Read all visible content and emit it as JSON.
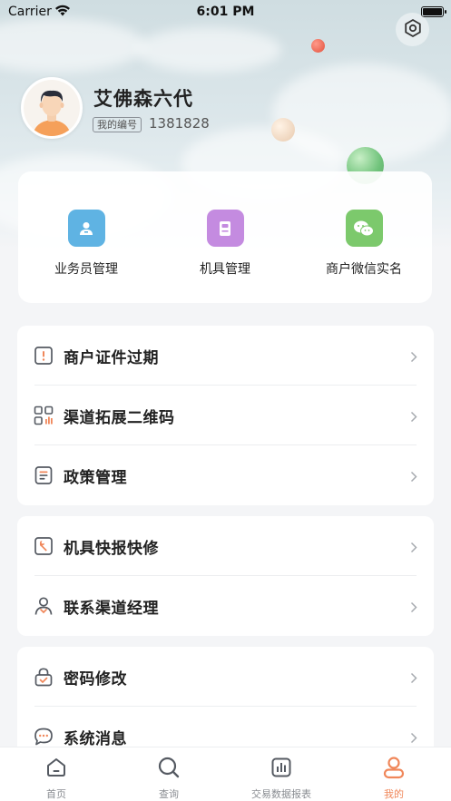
{
  "status_bar": {
    "carrier": "Carrier",
    "time": "6:01 PM"
  },
  "profile": {
    "name": "艾佛森六代",
    "id_label": "我的编号",
    "id_value": "1381828"
  },
  "quick_actions": [
    {
      "label": "业务员管理",
      "icon": "salesman-icon",
      "color": "#5fb3e3"
    },
    {
      "label": "机具管理",
      "icon": "device-icon",
      "color": "#c48be0"
    },
    {
      "label": "商户微信实名",
      "icon": "wechat-icon",
      "color": "#7cc96c"
    }
  ],
  "groups": [
    [
      {
        "label": "商户证件过期",
        "icon": "alert-icon"
      },
      {
        "label": "渠道拓展二维码",
        "icon": "qrcode-icon"
      },
      {
        "label": "政策管理",
        "icon": "document-icon"
      }
    ],
    [
      {
        "label": "机具快报快修",
        "icon": "wrench-icon"
      },
      {
        "label": "联系渠道经理",
        "icon": "contact-icon"
      }
    ],
    [
      {
        "label": "密码修改",
        "icon": "lock-icon"
      },
      {
        "label": "系统消息",
        "icon": "message-icon"
      }
    ]
  ],
  "tabs": [
    {
      "label": "首页",
      "icon": "home-icon",
      "active": false
    },
    {
      "label": "查询",
      "icon": "search-icon",
      "active": false
    },
    {
      "label": "交易数据报表",
      "icon": "report-icon",
      "active": false
    },
    {
      "label": "我的",
      "icon": "profile-icon",
      "active": true
    }
  ],
  "colors": {
    "accent": "#f0875a",
    "icon_outline": "#555a62"
  }
}
